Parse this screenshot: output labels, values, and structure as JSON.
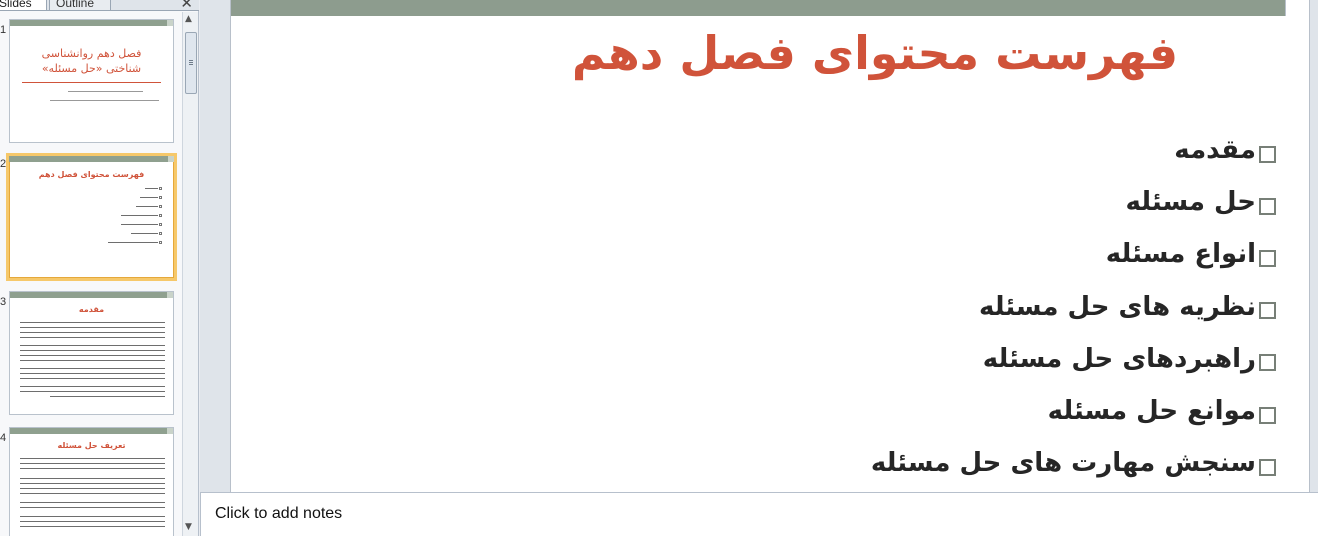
{
  "pane": {
    "tabs": [
      {
        "label": "Slides"
      },
      {
        "label": "Outline"
      }
    ],
    "close_glyph": "✕",
    "thumbnails": [
      {
        "number": "1",
        "title": "فصل دهم روانشناسی شناختی «حل مسئله»",
        "selected": false
      },
      {
        "number": "2",
        "title": "فهرست محتوای فصل دهم",
        "selected": true
      },
      {
        "number": "3",
        "title": "مقدمه",
        "selected": false
      },
      {
        "number": "4",
        "title": "تعریف حل مسئله",
        "selected": false
      }
    ]
  },
  "slide": {
    "title": "فهرست محتوای فصل دهم",
    "bullets": [
      {
        "text": "مقدمه"
      },
      {
        "text": "حل مسئله"
      },
      {
        "text": "انواع مسئله"
      },
      {
        "text": "نظریه های حل مسئله"
      },
      {
        "text": "راهبردهای حل مسئله"
      },
      {
        "text": "موانع حل مسئله"
      },
      {
        "text": "سنجش مهارت های حل مسئله"
      }
    ],
    "bullet_icon": "checkbox-square-icon"
  },
  "notes": {
    "placeholder": "Click to add notes"
  },
  "colors": {
    "title_red": "#d0533a",
    "accent_bar": "#8d9c8e",
    "selection": "#f6c86a"
  }
}
